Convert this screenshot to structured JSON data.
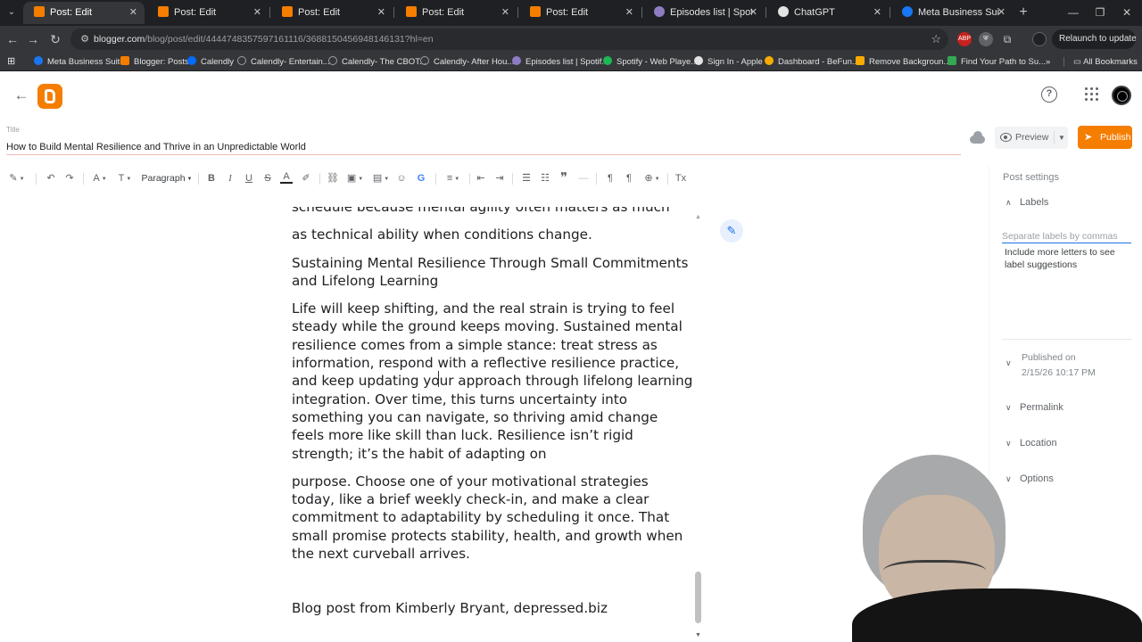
{
  "browser": {
    "tabs": [
      {
        "title": "Post: Edit",
        "fav_color": "#f57d00"
      },
      {
        "title": "Post: Edit",
        "fav_color": "#f57d00"
      },
      {
        "title": "Post: Edit",
        "fav_color": "#f57d00"
      },
      {
        "title": "Post: Edit",
        "fav_color": "#f57d00"
      },
      {
        "title": "Post: Edit",
        "fav_color": "#f57d00"
      },
      {
        "title": "Episodes list | Spotify for",
        "fav_color": "#8e7cc3"
      },
      {
        "title": "ChatGPT",
        "fav_color": "#e3e3e3"
      },
      {
        "title": "Meta Business Suite",
        "fav_color": "#1877f2"
      }
    ],
    "url_host": "blogger.com",
    "url_path": "/blog/post/edit/4444748357597161116/3688150456948146131?hl=en",
    "relaunch_label": "Relaunch to update",
    "bookmarks": [
      {
        "label": "Meta Business Suite",
        "color": "#1877f2"
      },
      {
        "label": "Blogger: Posts",
        "color": "#f57d00"
      },
      {
        "label": "Calendly",
        "color": "#006bff"
      },
      {
        "label": "Calendly- Entertain...",
        "color": "#9aa0a6"
      },
      {
        "label": "Calendly- The CBOT...",
        "color": "#9aa0a6"
      },
      {
        "label": "Calendly- After Hou...",
        "color": "#9aa0a6"
      },
      {
        "label": "Episodes list | Spotif...",
        "color": "#8e7cc3"
      },
      {
        "label": "Spotify - Web Playe...",
        "color": "#1db954"
      },
      {
        "label": "Sign In - Apple",
        "color": "#e3e3e3"
      },
      {
        "label": "Dashboard - BeFun...",
        "color": "#f9ab00"
      },
      {
        "label": "Remove Backgroun...",
        "color": "#f9ab00"
      },
      {
        "label": "Find Your Path to Su...",
        "color": "#34a853"
      }
    ],
    "all_bookmarks_label": "All Bookmarks"
  },
  "post": {
    "title_label": "Title",
    "title": "How to Build Mental Resilience and Thrive in an Unpredictable World",
    "preview_label": "Preview",
    "publish_label": "Publish",
    "paragraph_style": "Paragraph"
  },
  "body": {
    "cut_text": "schedule because mental agility often matters as much",
    "p1_end": "as technical ability when conditions change.",
    "heading": "Sustaining Mental Resilience Through Small Commitments and Lifelong Learning",
    "p2": "Life will keep shifting, and the real strain is trying to feel steady while the ground keeps moving. Sustained mental resilience comes from a simple stance: treat stress as information, respond with a reflective resilience practice, and keep updating your approach through lifelong learning integration. Over time, this turns uncertainty into something you can navigate, so thriving amid change feels more like skill than luck. Resilience isn’t rigid strength; it’s the habit of adapting on",
    "p3": "purpose. Choose one of your motivational strategies today, like a brief weekly check-in, and make a clear commitment to adaptability by scheduling it once. That small promise protects stability, health, and growth when the next curveball arrives.",
    "signature": "Blog post from Kimberly Bryant, depressed.biz"
  },
  "settings": {
    "header": "Post settings",
    "labels_label": "Labels",
    "labels_placeholder": "Separate labels by commas",
    "labels_hint": "Include more letters to see label suggestions",
    "published_label": "Published on",
    "published_value": "2/15/26 10:17 PM",
    "permalink_label": "Permalink",
    "location_label": "Location",
    "options_label": "Options"
  },
  "colors": {
    "accent": "#f57d00",
    "link_blue": "#1a73e8"
  }
}
